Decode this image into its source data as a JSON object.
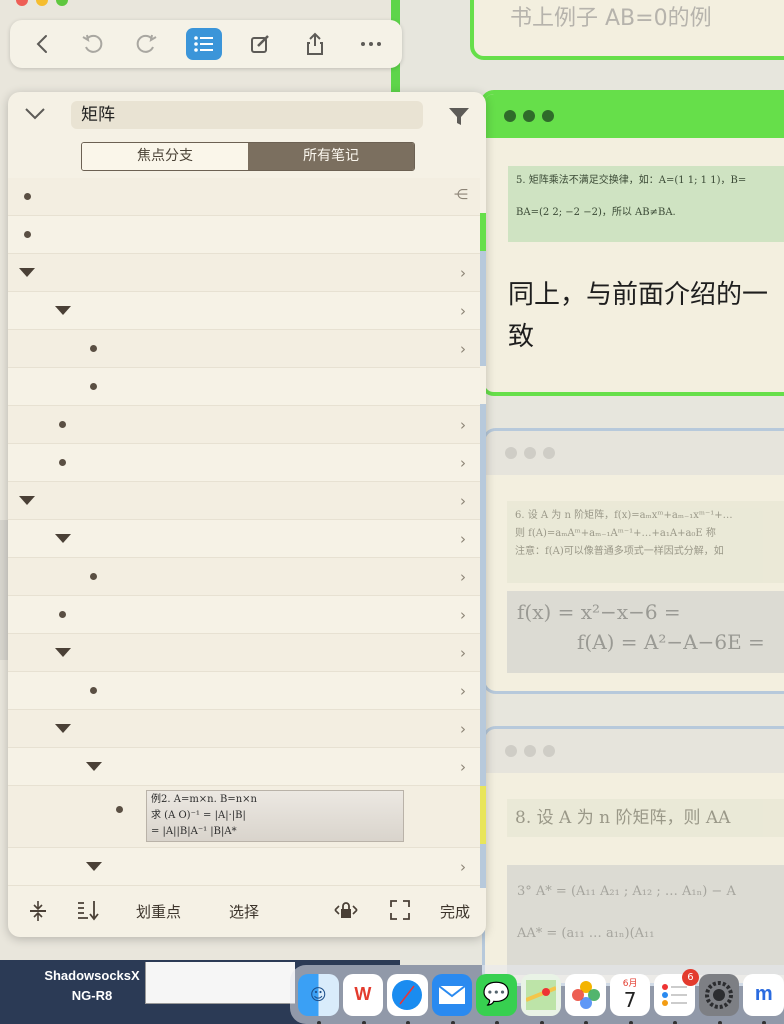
{
  "toolbar": {
    "buttons": [
      "back",
      "undo",
      "redo",
      "outline",
      "edit",
      "share",
      "more"
    ]
  },
  "panel": {
    "title": "矩阵",
    "segments": {
      "left": "焦点分支",
      "right": "所有笔记"
    },
    "footer": {
      "highlight": "划重点",
      "select": "选择",
      "done": "完成"
    }
  },
  "cards": {
    "card1_title": "书上例子 AB=0的例",
    "card2_scan_line1": "5. 矩阵乘法不满足交换律，如：A=(1 1; 1 1)，B=",
    "card2_scan_line2": "BA=(2 2; −2 −2)，所以 AB≠BA.",
    "card2_text": "同上，与前面介绍的一致",
    "card3_scan_line1": "6. 设 A 为 n 阶矩阵，f(x)=aₘxᵐ+aₘ₋₁xᵐ⁻¹+…",
    "card3_scan_line2": "则 f(A)=aₘAᵐ+aₘ₋₁Aᵐ⁻¹+…+a₁A+a₀E 称",
    "card3_scan_line3": "注意：f(A)可以像普通多项式一样因式分解，如",
    "card3_hand_line1": "f(x) = x²−x−6  =",
    "card3_hand_line2": "f(A) = A²−A−6E  =",
    "card4_scan": "8. 设 A 为 n 阶矩阵，则 AA",
    "card4_hand_line1": "3°  A* = (A₁₁ A₂₁ ; A₁₂ ; … A₁ₙ) − A",
    "card4_hand_line2": "AA* = (a₁₁ … a₁ₙ)(A₁₁"
  },
  "thumb_text": {
    "line1": "例2. A=m×n. B=n×n",
    "line2": "求 (A O)⁻¹ = |A|·|B|",
    "line3": "= |A||B|A⁻¹  |B|A*"
  },
  "desktop": {
    "app_label_line1": "ShadowsocksX",
    "app_label_line2": "NG-R8"
  },
  "dock": {
    "calendar_month": "6月",
    "calendar_day": "7",
    "reminders_badge": "6"
  }
}
